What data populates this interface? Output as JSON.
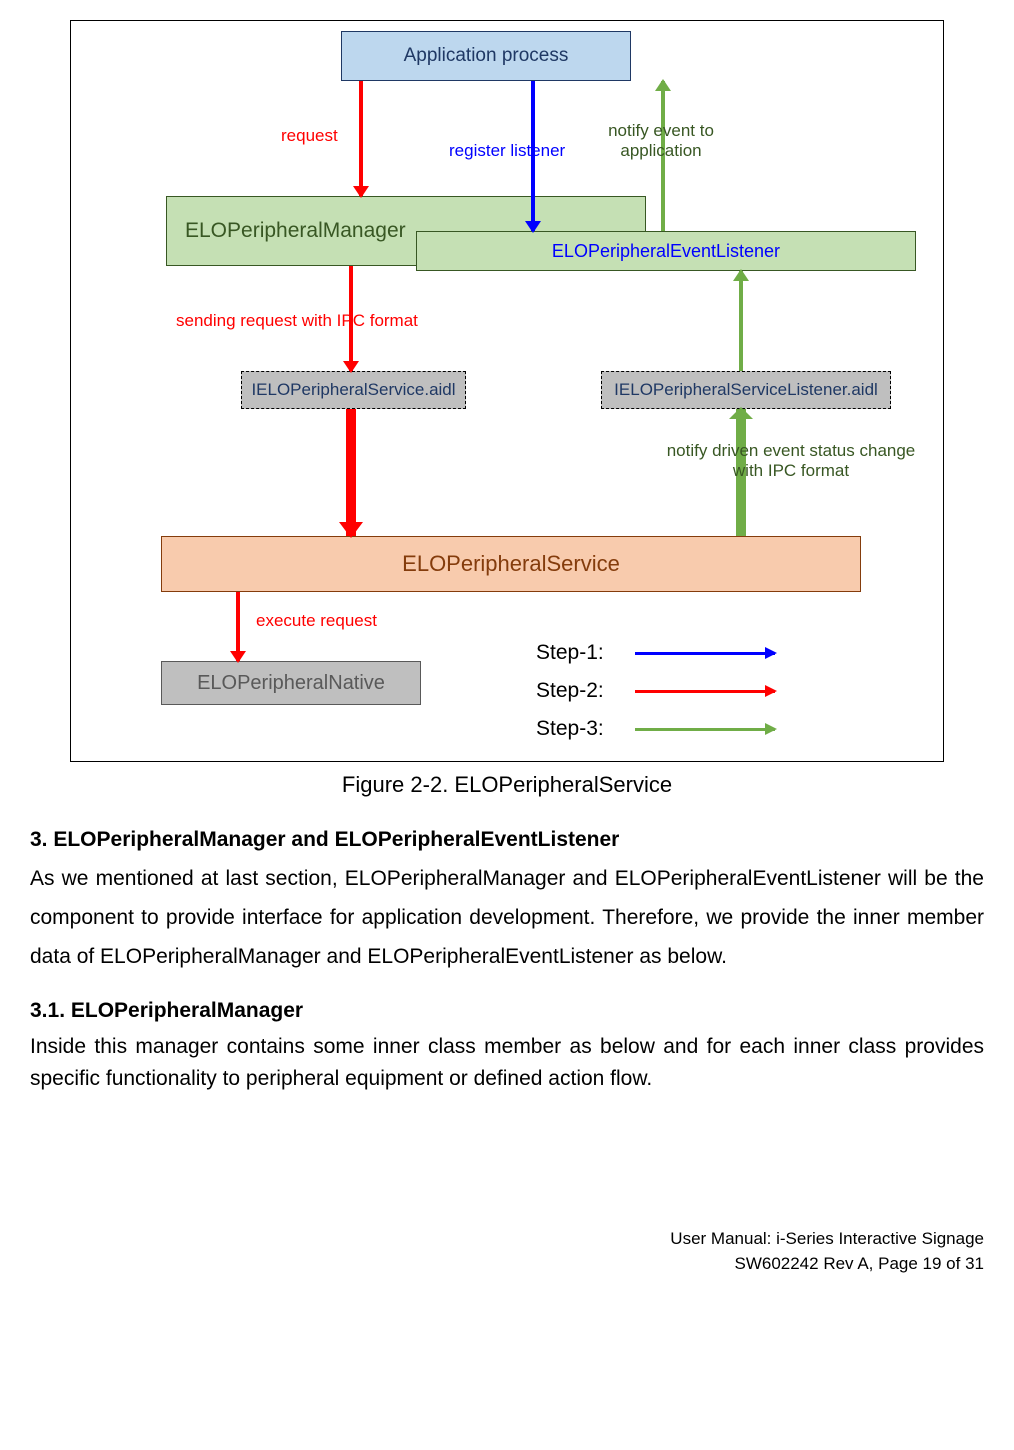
{
  "diagram": {
    "boxes": {
      "app": "Application process",
      "pm": "ELOPeripheralManager",
      "pm_inner": "ELOPeripheralEventListener",
      "aidl1": "IELOPeripheralService.aidl",
      "aidl2": "IELOPeripheralServiceListener.aidl",
      "service": "ELOPeripheralService",
      "native": "ELOPeripheralNative"
    },
    "labels": {
      "request": "request",
      "register": "register listener",
      "notify_event": "notify event to application",
      "sending": "sending request with IPC format",
      "notify_driven": "notify driven event status change with IPC format",
      "execute": "execute request"
    },
    "legend": {
      "step1": "Step-1:",
      "step2": "Step-2:",
      "step3": "Step-3:"
    }
  },
  "caption": "Figure 2-2. ELOPeripheralService",
  "section3": {
    "heading": "3. ELOPeripheralManager and ELOPeripheralEventListener",
    "body": "As we mentioned at last section, ELOPeripheralManager and ELOPeripheralEventListener will be the component to provide interface for application development. Therefore, we provide the inner member data of ELOPeripheralManager and ELOPeripheralEventListener as below."
  },
  "section31": {
    "heading": "3.1. ELOPeripheralManager",
    "body": "Inside this manager contains some inner class member as below and for each inner class provides specific functionality to peripheral equipment or defined action flow."
  },
  "footer": {
    "line1": "User Manual: i-Series Interactive Signage",
    "line2": "SW602242 Rev A, Page 19 of 31"
  }
}
